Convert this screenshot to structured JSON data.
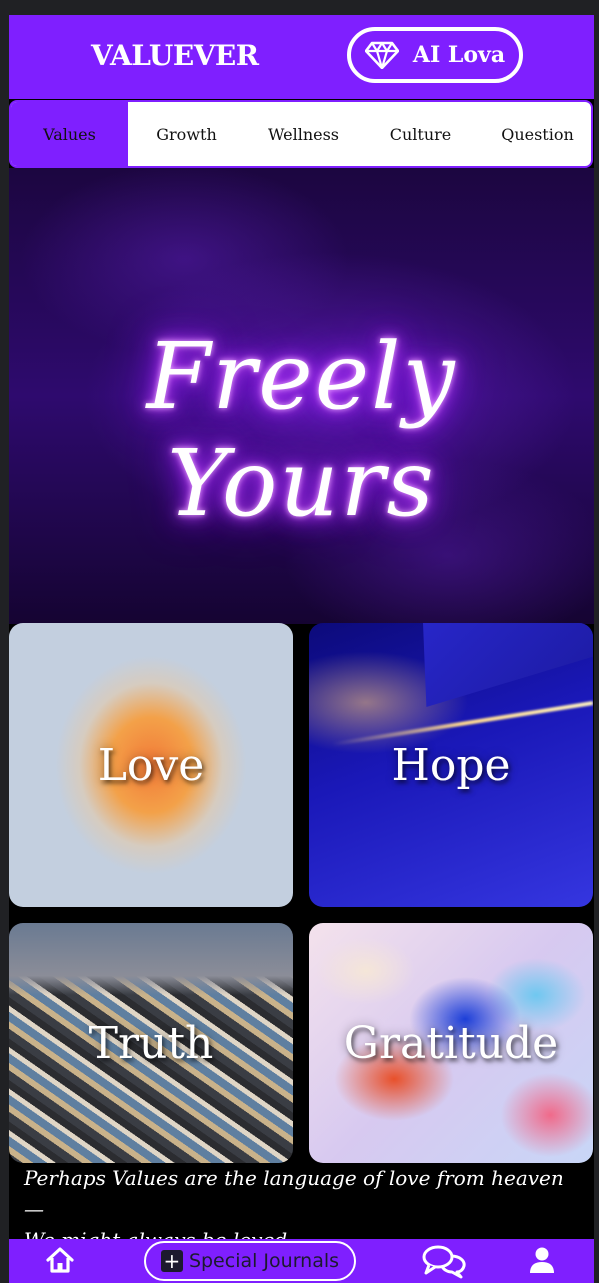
{
  "header": {
    "brand": "VALUEVER",
    "ai_button_label": "AI Lova",
    "ai_button_icon": "diamond-icon"
  },
  "tabs": [
    {
      "label": "Values",
      "active": true
    },
    {
      "label": "Growth",
      "active": false
    },
    {
      "label": "Wellness",
      "active": false
    },
    {
      "label": "Culture",
      "active": false
    },
    {
      "label": "Question",
      "active": false
    }
  ],
  "hero": {
    "text": "Freely Yours"
  },
  "cards": [
    {
      "label": "Love"
    },
    {
      "label": "Hope"
    },
    {
      "label": "Truth"
    },
    {
      "label": "Gratitude"
    }
  ],
  "quote": {
    "line1": "Perhaps Values are the language of love from heaven —",
    "line2": "We might always be loved."
  },
  "bottom_nav": {
    "home_icon": "home-icon",
    "special_label": "Special Journals",
    "special_icon": "plus-icon",
    "chat_icon": "chat-icon",
    "profile_icon": "user-icon"
  },
  "colors": {
    "accent": "#7f1fff",
    "background": "#000000",
    "text_light": "#ffffff"
  }
}
